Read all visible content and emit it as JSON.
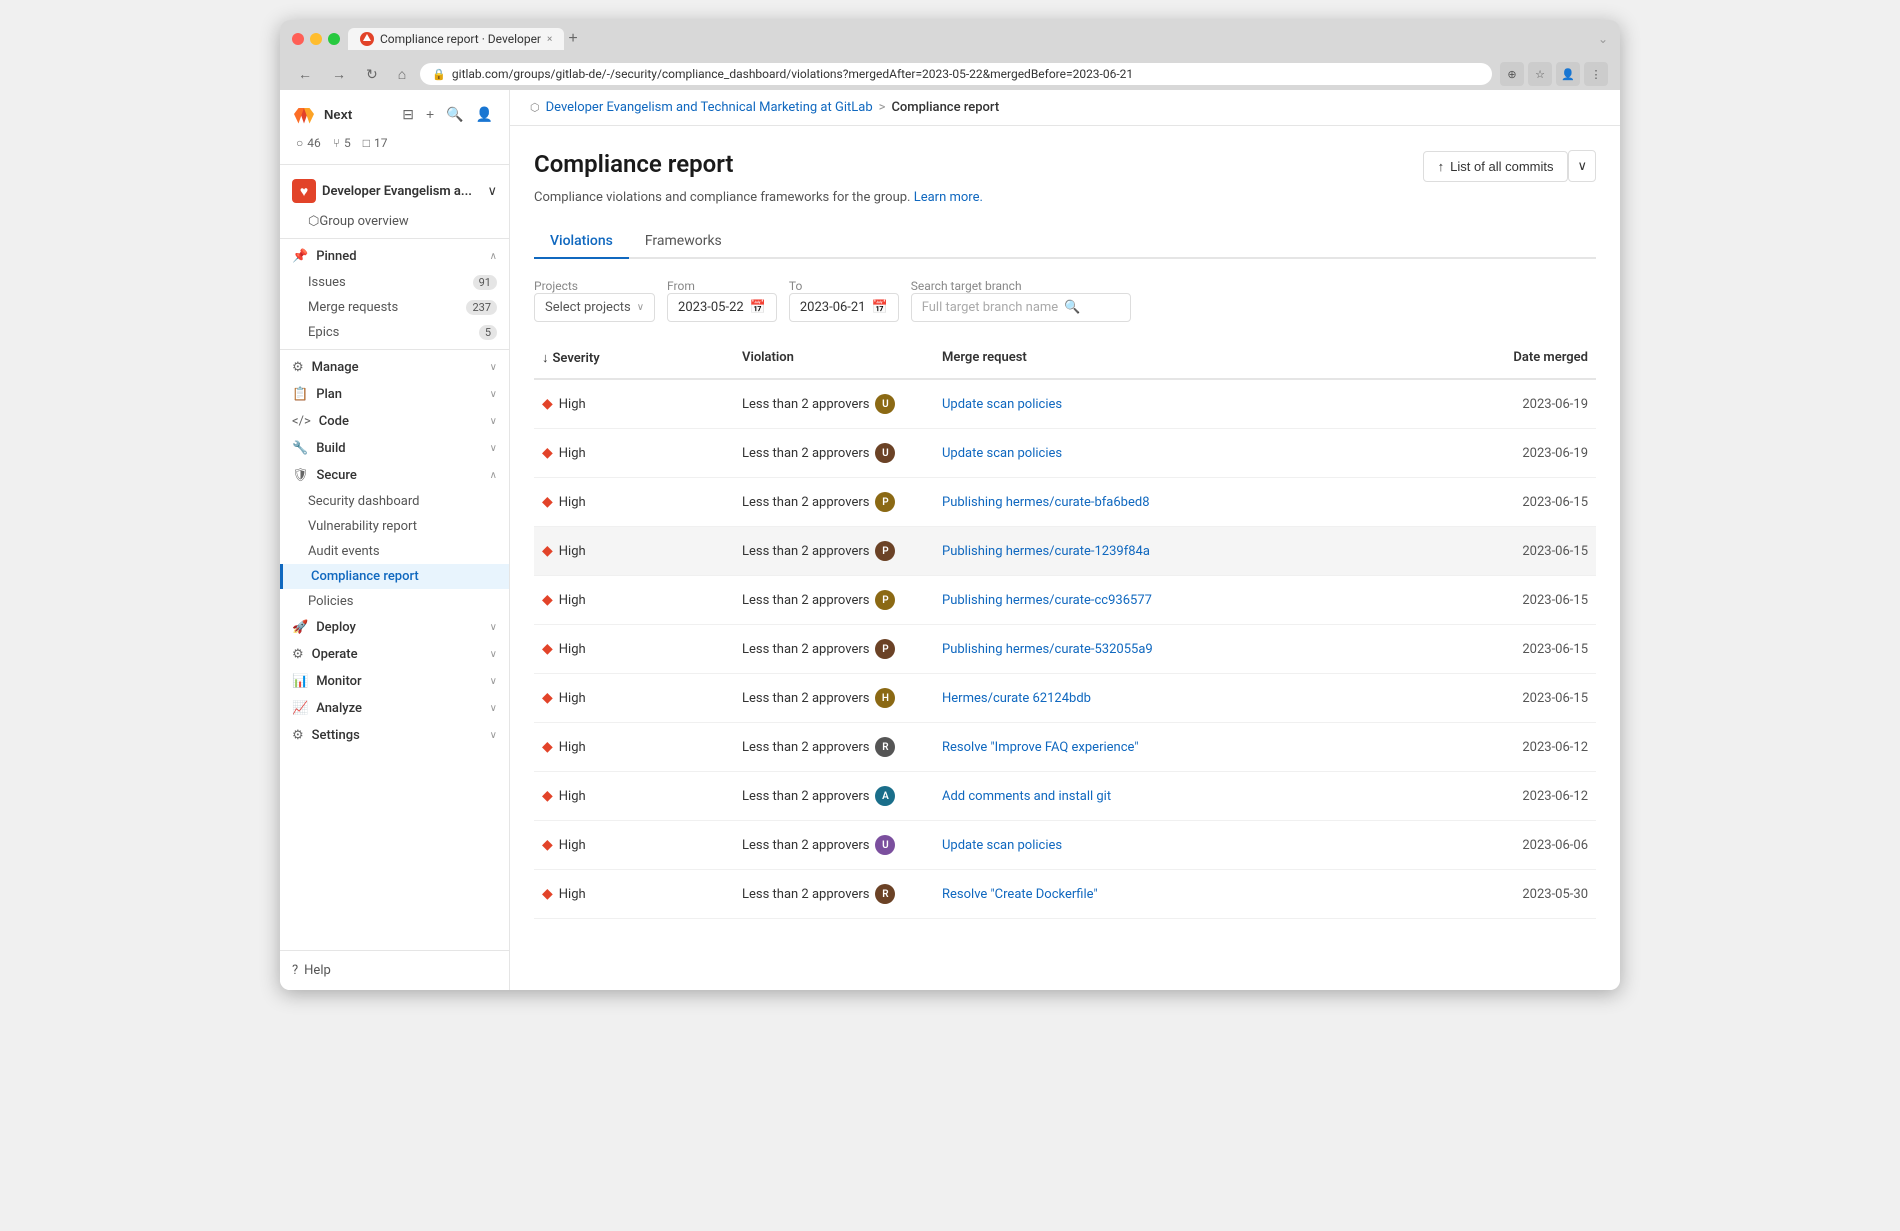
{
  "browser": {
    "tab_title": "Compliance report · Developer",
    "url": "gitlab.com/groups/gitlab-de/-/security/compliance_dashboard/violations?mergedAfter=2023-05-22&mergedBefore=2023-06-21",
    "new_tab_label": "+",
    "close_tab": "×"
  },
  "sidebar": {
    "next_label": "Next",
    "counters": [
      {
        "icon": "⎔",
        "count": "46",
        "label": "issues"
      },
      {
        "icon": "⑂",
        "count": "5",
        "label": "merge requests"
      },
      {
        "icon": "□",
        "count": "17",
        "label": "todos"
      }
    ],
    "group": {
      "name": "Developer Evangelism a...",
      "chevron": "∨"
    },
    "nav": [
      {
        "id": "group-overview",
        "label": "Group overview",
        "icon": "⬡",
        "type": "item",
        "indent": false
      },
      {
        "id": "pinned",
        "label": "Pinned",
        "icon": "📌",
        "type": "group",
        "expanded": true,
        "chevron": "∧"
      },
      {
        "id": "issues",
        "label": "Issues",
        "type": "subitem",
        "badge": "91"
      },
      {
        "id": "merge-requests",
        "label": "Merge requests",
        "type": "subitem",
        "badge": "237"
      },
      {
        "id": "epics",
        "label": "Epics",
        "type": "subitem",
        "badge": "5"
      },
      {
        "id": "manage",
        "label": "Manage",
        "icon": "⚙",
        "type": "group",
        "chevron": "∨"
      },
      {
        "id": "plan",
        "label": "Plan",
        "icon": "📋",
        "type": "group",
        "chevron": "∨"
      },
      {
        "id": "code",
        "label": "Code",
        "icon": "</>",
        "type": "group",
        "chevron": "∨"
      },
      {
        "id": "build",
        "label": "Build",
        "icon": "🔧",
        "type": "group",
        "chevron": "∨"
      },
      {
        "id": "secure",
        "label": "Secure",
        "icon": "🛡",
        "type": "group",
        "chevron": "∧",
        "expanded": true
      },
      {
        "id": "security-dashboard",
        "label": "Security dashboard",
        "type": "subitem"
      },
      {
        "id": "vulnerability-report",
        "label": "Vulnerability report",
        "type": "subitem"
      },
      {
        "id": "audit-events",
        "label": "Audit events",
        "type": "subitem"
      },
      {
        "id": "compliance-report",
        "label": "Compliance report",
        "type": "subitem",
        "active": true
      },
      {
        "id": "policies",
        "label": "Policies",
        "type": "subitem"
      },
      {
        "id": "deploy",
        "label": "Deploy",
        "icon": "🚀",
        "type": "group",
        "chevron": "∨"
      },
      {
        "id": "operate",
        "label": "Operate",
        "icon": "⚙",
        "type": "group",
        "chevron": "∨"
      },
      {
        "id": "monitor",
        "label": "Monitor",
        "icon": "📊",
        "type": "group",
        "chevron": "∨"
      },
      {
        "id": "analyze",
        "label": "Analyze",
        "icon": "📈",
        "type": "group",
        "chevron": "∨"
      },
      {
        "id": "settings",
        "label": "Settings",
        "icon": "⚙",
        "type": "group",
        "chevron": "∨"
      }
    ],
    "help_label": "Help"
  },
  "breadcrumb": {
    "parent": "Developer Evangelism and Technical Marketing at GitLab",
    "separator": ">",
    "current": "Compliance report"
  },
  "page": {
    "title": "Compliance report",
    "description": "Compliance violations and compliance frameworks for the group.",
    "learn_more": "Learn more.",
    "list_commits_btn": "List of all commits"
  },
  "tabs": [
    {
      "id": "violations",
      "label": "Violations",
      "active": true
    },
    {
      "id": "frameworks",
      "label": "Frameworks",
      "active": false
    }
  ],
  "filters": {
    "projects": {
      "label": "Select projects",
      "placeholder": "Select projects"
    },
    "from": {
      "label": "From",
      "value": "2023-05-22"
    },
    "to": {
      "label": "To",
      "value": "2023-06-21"
    },
    "search_branch": {
      "placeholder": "Full target branch name"
    }
  },
  "table": {
    "columns": [
      {
        "id": "severity",
        "label": "↓ Severity",
        "sortable": true
      },
      {
        "id": "violation",
        "label": "Violation"
      },
      {
        "id": "merge_request",
        "label": "Merge request"
      },
      {
        "id": "date_merged",
        "label": "Date merged"
      }
    ],
    "rows": [
      {
        "severity": "High",
        "violation": "Less than 2 approvers",
        "merge_request": "Update scan policies",
        "date": "2023-06-19",
        "avatar_color": "#8B6914",
        "avatar_initials": "U",
        "highlighted": false
      },
      {
        "severity": "High",
        "violation": "Less than 2 approvers",
        "merge_request": "Update scan policies",
        "date": "2023-06-19",
        "avatar_color": "#6B4226",
        "avatar_initials": "U",
        "highlighted": false
      },
      {
        "severity": "High",
        "violation": "Less than 2 approvers",
        "merge_request": "Publishing hermes/curate-bfa6bed8",
        "date": "2023-06-15",
        "avatar_color": "#8B6914",
        "avatar_initials": "P",
        "highlighted": false
      },
      {
        "severity": "High",
        "violation": "Less than 2 approvers",
        "merge_request": "Publishing hermes/curate-1239f84a",
        "date": "2023-06-15",
        "avatar_color": "#6B4226",
        "avatar_initials": "P",
        "highlighted": true
      },
      {
        "severity": "High",
        "violation": "Less than 2 approvers",
        "merge_request": "Publishing hermes/curate-cc936577",
        "date": "2023-06-15",
        "avatar_color": "#8B6914",
        "avatar_initials": "P",
        "highlighted": false
      },
      {
        "severity": "High",
        "violation": "Less than 2 approvers",
        "merge_request": "Publishing hermes/curate-532055a9",
        "date": "2023-06-15",
        "avatar_color": "#6B4226",
        "avatar_initials": "P",
        "highlighted": false
      },
      {
        "severity": "High",
        "violation": "Less than 2 approvers",
        "merge_request": "Hermes/curate 62124bdb",
        "date": "2023-06-15",
        "avatar_color": "#8B6914",
        "avatar_initials": "H",
        "highlighted": false
      },
      {
        "severity": "High",
        "violation": "Less than 2 approvers",
        "merge_request": "Resolve \"Improve FAQ experience\"",
        "date": "2023-06-12",
        "avatar_color": "#555",
        "avatar_initials": "R",
        "highlighted": false
      },
      {
        "severity": "High",
        "violation": "Less than 2 approvers",
        "merge_request": "Add comments and install git",
        "date": "2023-06-12",
        "avatar_color": "#1a6e8a",
        "avatar_initials": "A",
        "highlighted": false
      },
      {
        "severity": "High",
        "violation": "Less than 2 approvers",
        "merge_request": "Update scan policies",
        "date": "2023-06-06",
        "avatar_color": "#7B4F9E",
        "avatar_initials": "U",
        "highlighted": false
      },
      {
        "severity": "High",
        "violation": "Less than 2 approvers",
        "merge_request": "Resolve \"Create Dockerfile\"",
        "date": "2023-05-30",
        "avatar_color": "#6B4226",
        "avatar_initials": "R",
        "highlighted": false
      }
    ]
  }
}
